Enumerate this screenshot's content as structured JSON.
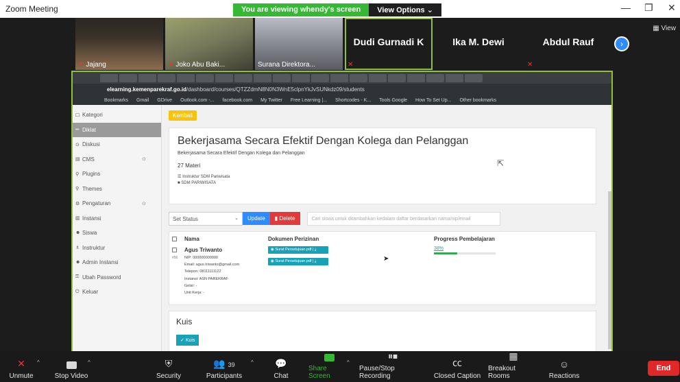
{
  "window": {
    "title": "Zoom Meeting",
    "share_banner": "You are viewing whendy's screen",
    "view_options": "View Options",
    "view_button": "View"
  },
  "participants": [
    {
      "name": "Jajang",
      "muted": true,
      "video": true
    },
    {
      "name": "Joko Abu Baki...",
      "muted": true,
      "video": true
    },
    {
      "name": "Surana Direktora...",
      "muted": false,
      "video": true
    },
    {
      "name": "Dudi Gurnadi K",
      "muted": true,
      "video": false,
      "active": true
    },
    {
      "name": "Ika M. Dewi",
      "muted": false,
      "video": false
    },
    {
      "name": "Abdul Rauf",
      "muted": true,
      "video": false
    }
  ],
  "browser": {
    "url_domain": "elearning.kemenparekraf.go.id",
    "url_path": "/dashboard/courses/QTZZdmN8N0N3WnE5clpnYkJvSUNkdz09/students",
    "bookmarks": [
      "Bookmarks",
      "Gmail",
      "GDrive",
      "Outlook.com -...",
      "facebook.com",
      "My Twitter",
      "Free Learning |...",
      "Shortcodes - K...",
      "Tools Google",
      "How To Set Up...",
      "Other bookmarks"
    ]
  },
  "sidebar": {
    "items": [
      {
        "label": "Kategori",
        "icon": "☐"
      },
      {
        "label": "Diklat",
        "icon": "✏"
      },
      {
        "label": "Diskusi",
        "icon": "⊙"
      },
      {
        "label": "CMS",
        "icon": "▤"
      },
      {
        "label": "Plugins",
        "icon": "⚲"
      },
      {
        "label": "Themes",
        "icon": "⚲"
      },
      {
        "label": "Pengaturan",
        "icon": "⚙"
      },
      {
        "label": "Instansi",
        "icon": "▥"
      },
      {
        "label": "Siswa",
        "icon": "☻"
      },
      {
        "label": "Instruktur",
        "icon": "♗"
      },
      {
        "label": "Admin Instansi",
        "icon": "☻"
      },
      {
        "label": "Ubah Password",
        "icon": "⚿"
      },
      {
        "label": "Keluar",
        "icon": "⏻"
      }
    ]
  },
  "course": {
    "back_label": "Kembali",
    "title": "Bekerjasama Secara Efektif Dengan Kolega dan Pelanggan",
    "subtitle": "Bekerjasama Secara Efektif Dengan Kolega dan Pelanggan",
    "materi_count": "27 Materi",
    "instructor": "Instruktur SDM Pariwisata",
    "org": "SDM PARIWISATA"
  },
  "actions": {
    "status_placeholder": "Set Status",
    "update_label": "Update",
    "delete_label": "Delete",
    "search_placeholder": "Cari siswa untuk ditambahkan kedalam daftar berdasarkan nama/nip/email"
  },
  "table": {
    "headers": {
      "name": "Nama",
      "docs": "Dokumen Perizinan",
      "progress": "Progress Pembelajaran"
    },
    "rows": [
      {
        "num": "#56",
        "name": "Agus Triwanto",
        "nip": "NIP: 000000000000",
        "email": "Email: agus.triwanto@gmail.com",
        "phone": "Telepon: 08111111122",
        "instansi": "Instansi: ASN PAREKRAF",
        "gelar": "Gelar: -",
        "unit": "Unit Kerja: -",
        "doc1": "Surat Persetujuan.pdf",
        "doc2": "Surat Persetujuan.pdf",
        "progress_text": "38%",
        "progress": 0.38
      }
    ]
  },
  "quiz": {
    "title": "Kuis",
    "button": "Kuis"
  },
  "toolbar": {
    "unmute": "Unmute",
    "stop_video": "Stop Video",
    "security": "Security",
    "participants": "Participants",
    "participant_count": "39",
    "chat": "Chat",
    "share_screen": "Share Screen",
    "recording": "Pause/Stop Recording",
    "closed_caption": "Closed Caption",
    "breakout": "Breakout Rooms",
    "reactions": "Reactions",
    "end": "End"
  }
}
